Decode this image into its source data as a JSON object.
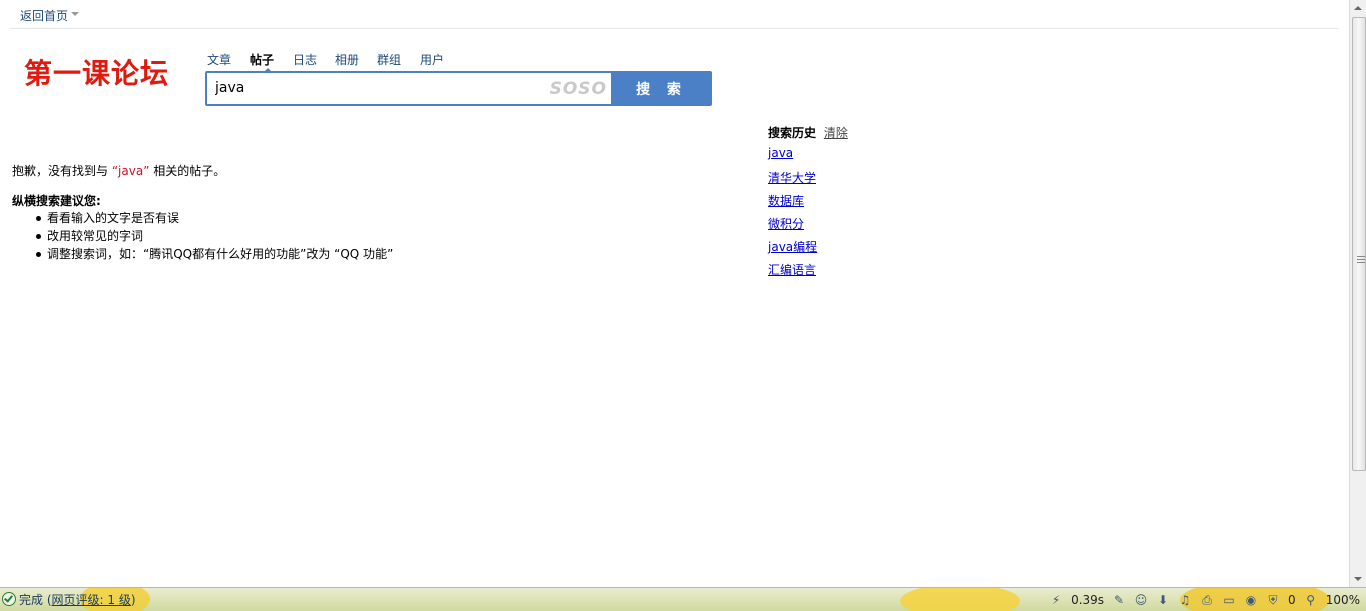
{
  "topbar": {
    "back_home": "返回首页"
  },
  "logo": {
    "text": "第一课论坛"
  },
  "tabs": [
    {
      "label": "文章",
      "active": false
    },
    {
      "label": "帖子",
      "active": true
    },
    {
      "label": "日志",
      "active": false
    },
    {
      "label": "相册",
      "active": false
    },
    {
      "label": "群组",
      "active": false
    },
    {
      "label": "用户",
      "active": false
    }
  ],
  "search": {
    "query": "java",
    "brand": "SOSO",
    "button_label": "搜 索"
  },
  "results": {
    "no_result_prefix": "抱歉，没有找到与 ",
    "no_result_keyword": "“java”",
    "no_result_suffix": " 相关的帖子。",
    "suggest_title": "纵横搜索建议您:",
    "suggestions": [
      "看看输入的文字是否有误",
      "改用较常见的字词",
      "调整搜索词，如：“腾讯QQ都有什么好用的功能”改为 “QQ 功能”"
    ]
  },
  "history": {
    "title": "搜索历史",
    "clear_label": "清除",
    "items": [
      "java",
      "清华大学",
      "数据库",
      "微积分",
      "java编程",
      "汇编语言"
    ]
  },
  "statusbar": {
    "status": "完成",
    "rating_open": "(",
    "rating": "网页评级: 1 级",
    "rating_close": ")",
    "load_time": "0.39s",
    "blocked_count": "0",
    "zoom": "100%"
  },
  "colors": {
    "logo": "#e01a0f",
    "search_bar": "#4c80c6",
    "keyword": "#c8102e",
    "link": "#0000cc",
    "tab_link": "#1e4a7a"
  }
}
